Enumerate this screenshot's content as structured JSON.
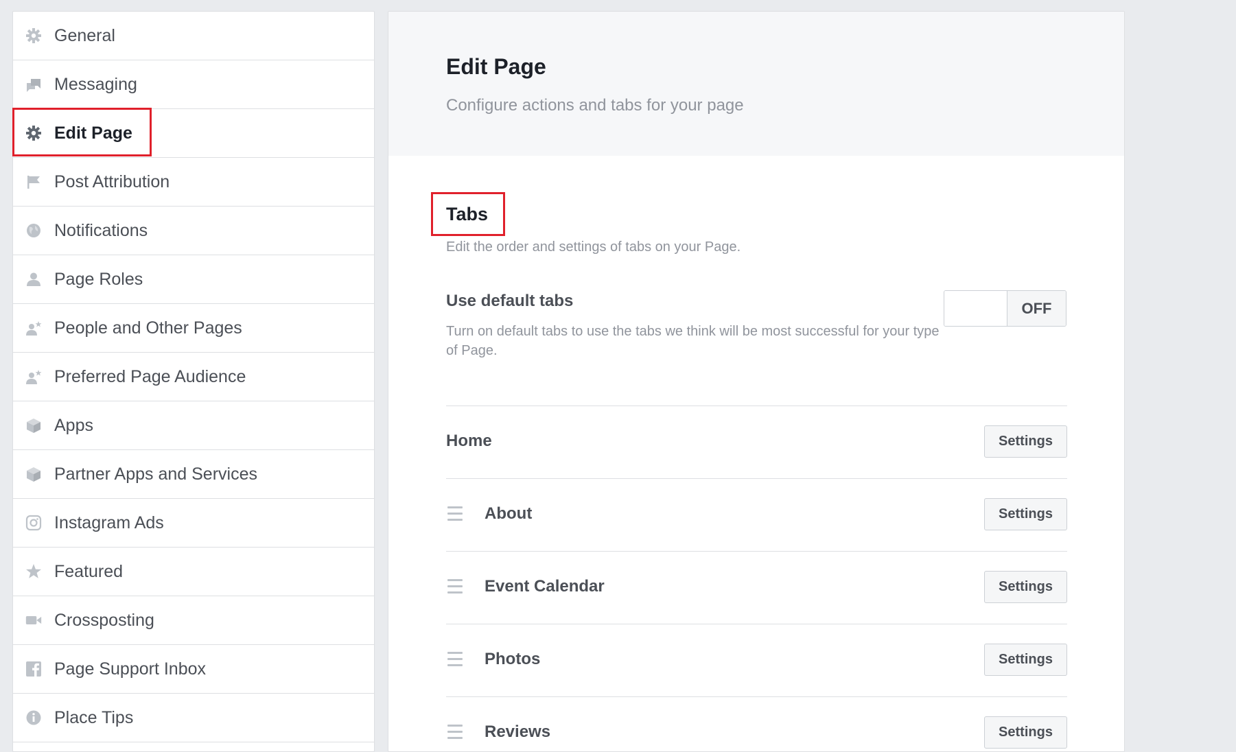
{
  "sidebar": {
    "items": [
      {
        "label": "General",
        "icon": "gear-icon"
      },
      {
        "label": "Messaging",
        "icon": "messages-icon"
      },
      {
        "label": "Edit Page",
        "icon": "gear-icon",
        "active": true
      },
      {
        "label": "Post Attribution",
        "icon": "flag-icon"
      },
      {
        "label": "Notifications",
        "icon": "globe-icon"
      },
      {
        "label": "Page Roles",
        "icon": "person-icon"
      },
      {
        "label": "People and Other Pages",
        "icon": "person-star-icon"
      },
      {
        "label": "Preferred Page Audience",
        "icon": "person-star-icon"
      },
      {
        "label": "Apps",
        "icon": "cube-icon"
      },
      {
        "label": "Partner Apps and Services",
        "icon": "cube-icon"
      },
      {
        "label": "Instagram Ads",
        "icon": "instagram-icon"
      },
      {
        "label": "Featured",
        "icon": "star-icon"
      },
      {
        "label": "Crossposting",
        "icon": "video-camera-icon"
      },
      {
        "label": "Page Support Inbox",
        "icon": "facebook-icon"
      },
      {
        "label": "Place Tips",
        "icon": "info-icon"
      }
    ]
  },
  "main": {
    "title": "Edit Page",
    "subtitle": "Configure actions and tabs for your page",
    "tabs_section": {
      "heading": "Tabs",
      "description": "Edit the order and settings of tabs on your Page."
    },
    "default_tabs": {
      "title": "Use default tabs",
      "description": "Turn on default tabs to use the tabs we think will be most successful for your type of Page.",
      "toggle_label": "OFF"
    },
    "tab_list": [
      {
        "name": "Home",
        "draggable": false,
        "button": "Settings"
      },
      {
        "name": "About",
        "draggable": true,
        "button": "Settings"
      },
      {
        "name": "Event Calendar",
        "draggable": true,
        "button": "Settings"
      },
      {
        "name": "Photos",
        "draggable": true,
        "button": "Settings"
      },
      {
        "name": "Reviews",
        "draggable": true,
        "button": "Settings"
      }
    ]
  },
  "colors": {
    "highlight": "#e0202b",
    "icon_gray": "#bec3c9",
    "text_dark": "#1d2129",
    "text_mid": "#4b4f56",
    "text_light": "#90949c"
  }
}
